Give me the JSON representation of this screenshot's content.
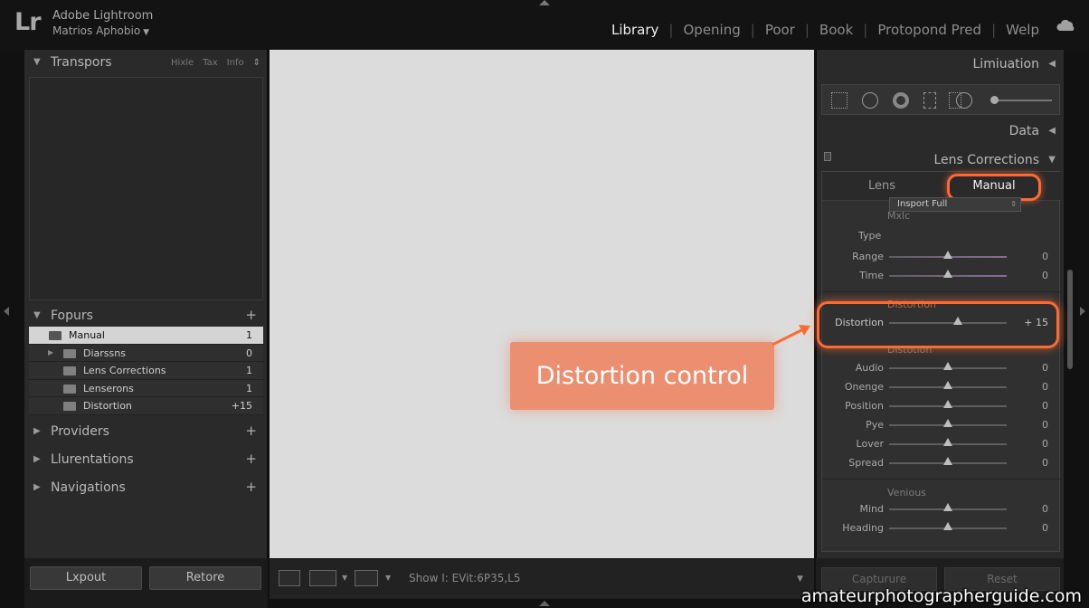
{
  "app": {
    "logo": "Lr",
    "title": "Adobe Lightroom",
    "catalog": "Matrioѕ Aphobio"
  },
  "modules": [
    "Library",
    "Opening",
    "Poor",
    "Book",
    "Protopond Pred",
    "Welp"
  ],
  "left": {
    "navigator": {
      "title": "Transpors",
      "options": [
        "Hixle",
        "Tax",
        "Info"
      ]
    },
    "folders": {
      "title": "Fopurs",
      "items": [
        {
          "name": "Manual",
          "count": "1"
        },
        {
          "name": "Diarssns",
          "count": "0"
        },
        {
          "name": "Lens Corrections",
          "count": "1"
        },
        {
          "name": "Lenserons",
          "count": "1"
        },
        {
          "name": "Distortion",
          "count": "+15"
        }
      ]
    },
    "providers": "Providers",
    "collections": "Llurentations",
    "navigations": "Navigations",
    "export_label": "Lxpout",
    "retore_label": "Retore"
  },
  "center": {
    "callout": "Distortion control",
    "toolbar_show": "Show I: EVit:6P35,L5"
  },
  "right": {
    "limitation": "Limiuation",
    "data": "Data",
    "lens_corrections": "Lens Corrections",
    "tabs": {
      "lens": "Lens",
      "manual": "Manual"
    },
    "mode_label": "Mxlc",
    "type_label": "Type",
    "type_value": "Insport Full",
    "range": {
      "label": "Range",
      "value": "0"
    },
    "time": {
      "label": "Time",
      "value": "0"
    },
    "distortion_section": "Distortion",
    "distortion": {
      "label": "Distortion",
      "value": "+ 15"
    },
    "distortion_section2": "Distotion",
    "sliders": [
      {
        "label": "Audio",
        "value": "0"
      },
      {
        "label": "Onenge",
        "value": "0"
      },
      {
        "label": "Position",
        "value": "0"
      },
      {
        "label": "Pye",
        "value": "0"
      },
      {
        "label": "Lover",
        "value": "0"
      },
      {
        "label": "Spread",
        "value": "0"
      }
    ],
    "vignette_section": "Venious",
    "vignette": [
      {
        "label": "Mind",
        "value": "0"
      },
      {
        "label": "Heading",
        "value": "0"
      }
    ],
    "capture_label": "Capturure",
    "reset_label": "Reset"
  },
  "watermark": "amateurphotographerguide.com",
  "colors": {
    "highlight": "#ff6a33",
    "callout": "#eb8f70"
  }
}
